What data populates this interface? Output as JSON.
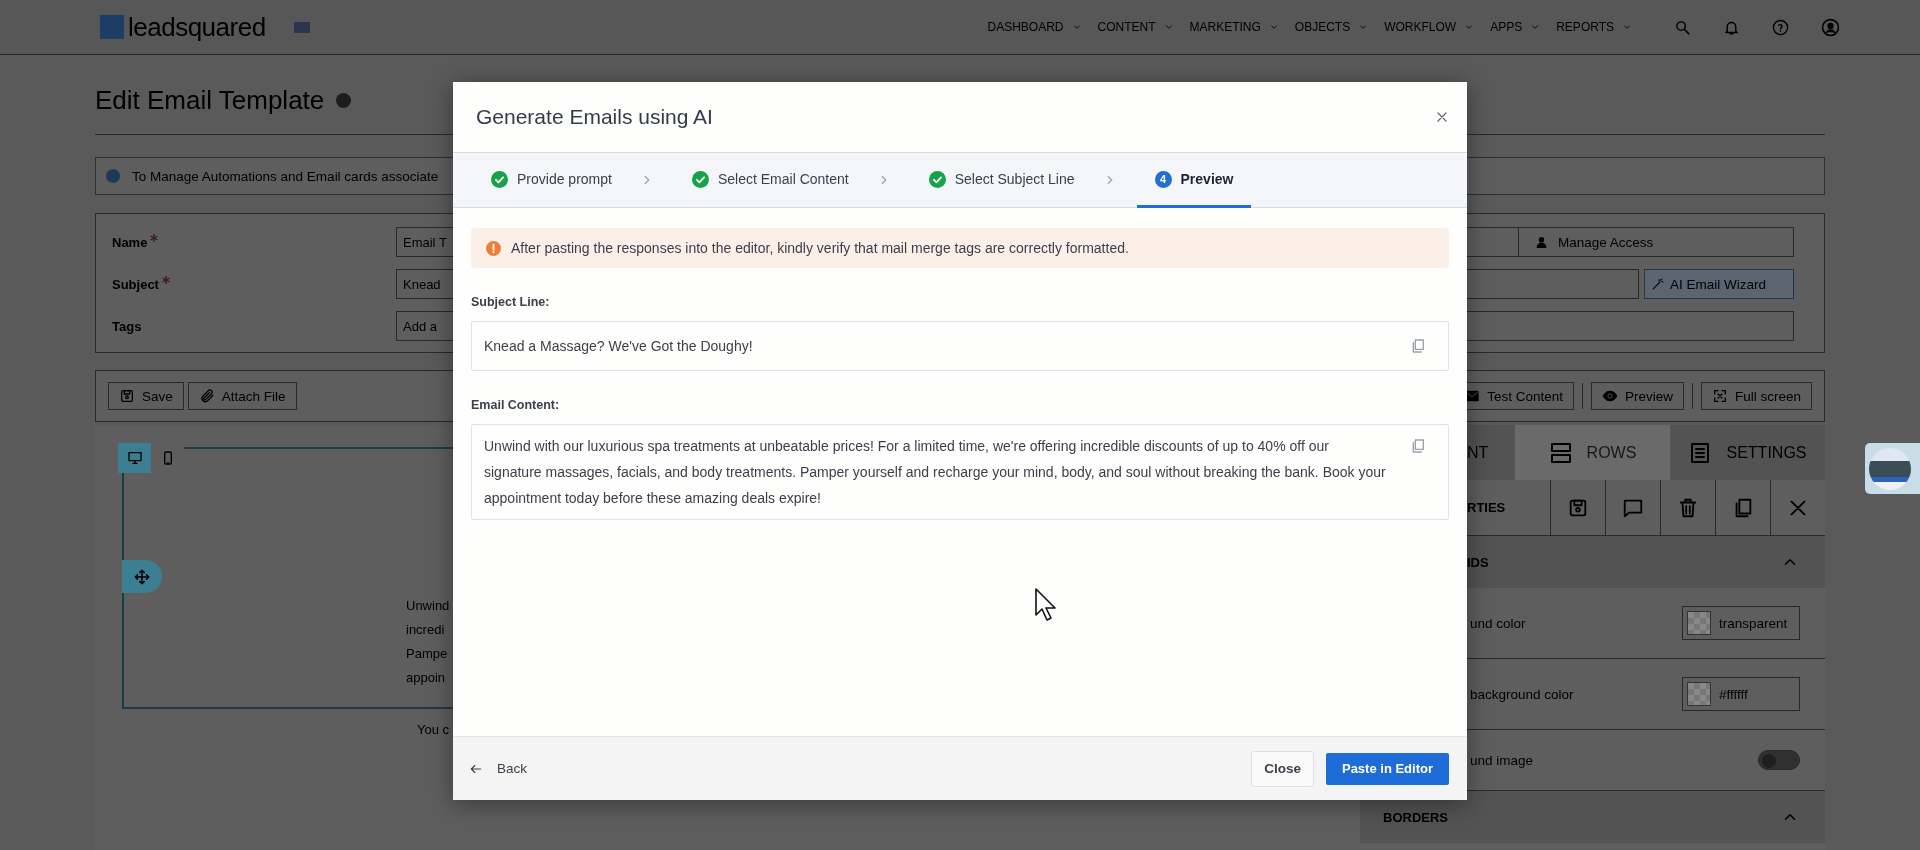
{
  "header": {
    "logo": "leadsquared",
    "nav": [
      {
        "label": "DASHBOARD"
      },
      {
        "label": "CONTENT"
      },
      {
        "label": "MARKETING"
      },
      {
        "label": "OBJECTS"
      },
      {
        "label": "WORKFLOW"
      },
      {
        "label": "APPS"
      },
      {
        "label": "REPORTS"
      }
    ]
  },
  "page": {
    "title": "Edit Email Template",
    "notice": "To Manage Automations and Email cards associate",
    "form": {
      "fields": [
        {
          "label": "Name",
          "required": true,
          "value": "Email T"
        },
        {
          "label": "Subject",
          "required": true,
          "value": "Knead"
        },
        {
          "label": "Tags",
          "required": false,
          "placeholder": "Add a"
        }
      ],
      "manage_access": "Manage Access",
      "ai_wizard": "AI Email Wizard"
    },
    "toolbar": {
      "left": [
        "Save",
        "Attach File"
      ],
      "right": [
        "Test Content",
        "Preview",
        "Full screen"
      ]
    },
    "editor": {
      "devices": [
        {
          "selected": true
        },
        {
          "selected": false
        }
      ],
      "preview_lines": [
        "Unwind",
        "incredi",
        "Pampe",
        "appoin"
      ],
      "footer_text": "You c"
    },
    "side_panel": {
      "tabs": [
        {
          "label": "NT",
          "selected": false
        },
        {
          "label": "ROWS",
          "selected": true
        },
        {
          "label": "SETTINGS",
          "selected": false
        }
      ],
      "properties_title": "RTIES",
      "sections": [
        {
          "title": "IDS",
          "expanded": true,
          "rows": [
            {
              "kind": "color",
              "label": "und color",
              "value": "transparent"
            },
            {
              "kind": "color",
              "label": "background color",
              "value": "#ffffff"
            },
            {
              "kind": "toggle",
              "label": "und image",
              "on": false
            }
          ]
        },
        {
          "title": "BORDERS",
          "expanded": true
        }
      ]
    }
  },
  "modal": {
    "title": "Generate Emails using AI",
    "steps": [
      {
        "label": "Provide prompt",
        "completed": true,
        "selected": false
      },
      {
        "label": "Select Email Content",
        "completed": true,
        "selected": false
      },
      {
        "label": "Select Subject Line",
        "completed": true,
        "selected": false
      },
      {
        "label": "Preview",
        "number": "4",
        "completed": false,
        "selected": true
      }
    ],
    "notice": "After pasting the responses into the editor, kindly verify that mail merge tags are correctly formatted.",
    "subject_label": "Subject Line:",
    "subject": "Knead a Massage? We've Got the Doughy!",
    "content_label": "Email Content:",
    "content": "Unwind with our luxurious spa treatments at unbeatable prices! For a limited time, we're offering incredible discounts of up to 40% off our signature massages, facials, and body treatments. Pamper yourself and recharge your mind, body, and soul without breaking the bank. Book your appointment today before these amazing deals expire!",
    "back": "Back",
    "buttons": [
      "Close",
      "Paste in Editor"
    ]
  }
}
